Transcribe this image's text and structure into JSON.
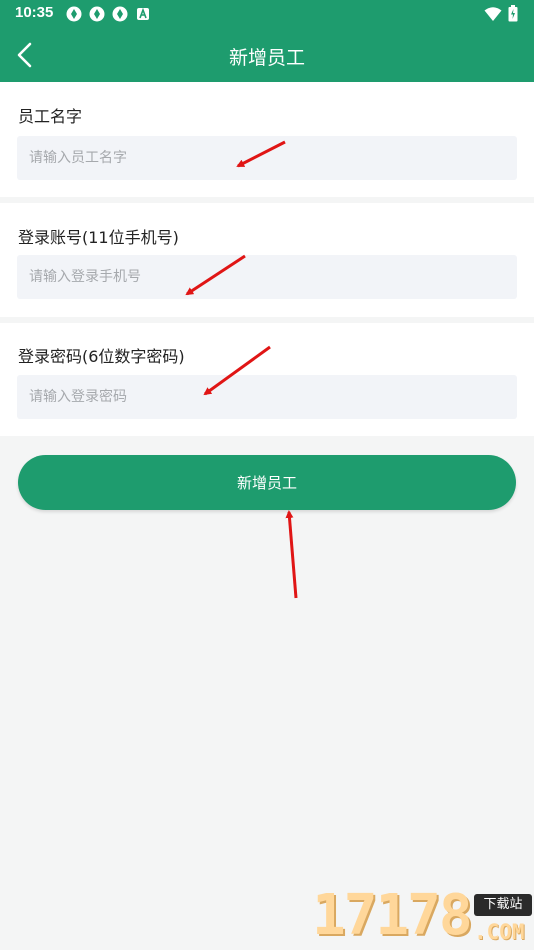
{
  "status_bar": {
    "time": "10:35",
    "icons": [
      "app-icon",
      "app-icon",
      "app-icon",
      "a-badge-icon"
    ],
    "right_icons": [
      "wifi-icon",
      "battery-icon"
    ]
  },
  "header": {
    "title": "新增员工",
    "back_icon": "chevron-left-icon",
    "background": "#1e9c6e"
  },
  "form": {
    "fields": [
      {
        "label": "员工名字",
        "placeholder": "请输入员工名字",
        "value": ""
      },
      {
        "label": "登录账号(11位手机号)",
        "placeholder": "请输入登录手机号",
        "value": ""
      },
      {
        "label": "登录密码(6位数字密码)",
        "placeholder": "请输入登录密码",
        "value": ""
      }
    ],
    "submit_label": "新增员工",
    "accent": "#1e9c6e"
  },
  "annotation_arrows": {
    "count": 4,
    "color": "#e01515"
  },
  "watermark": {
    "numbers": "17178",
    "tag": "下载站",
    "suffix": ".COM"
  }
}
